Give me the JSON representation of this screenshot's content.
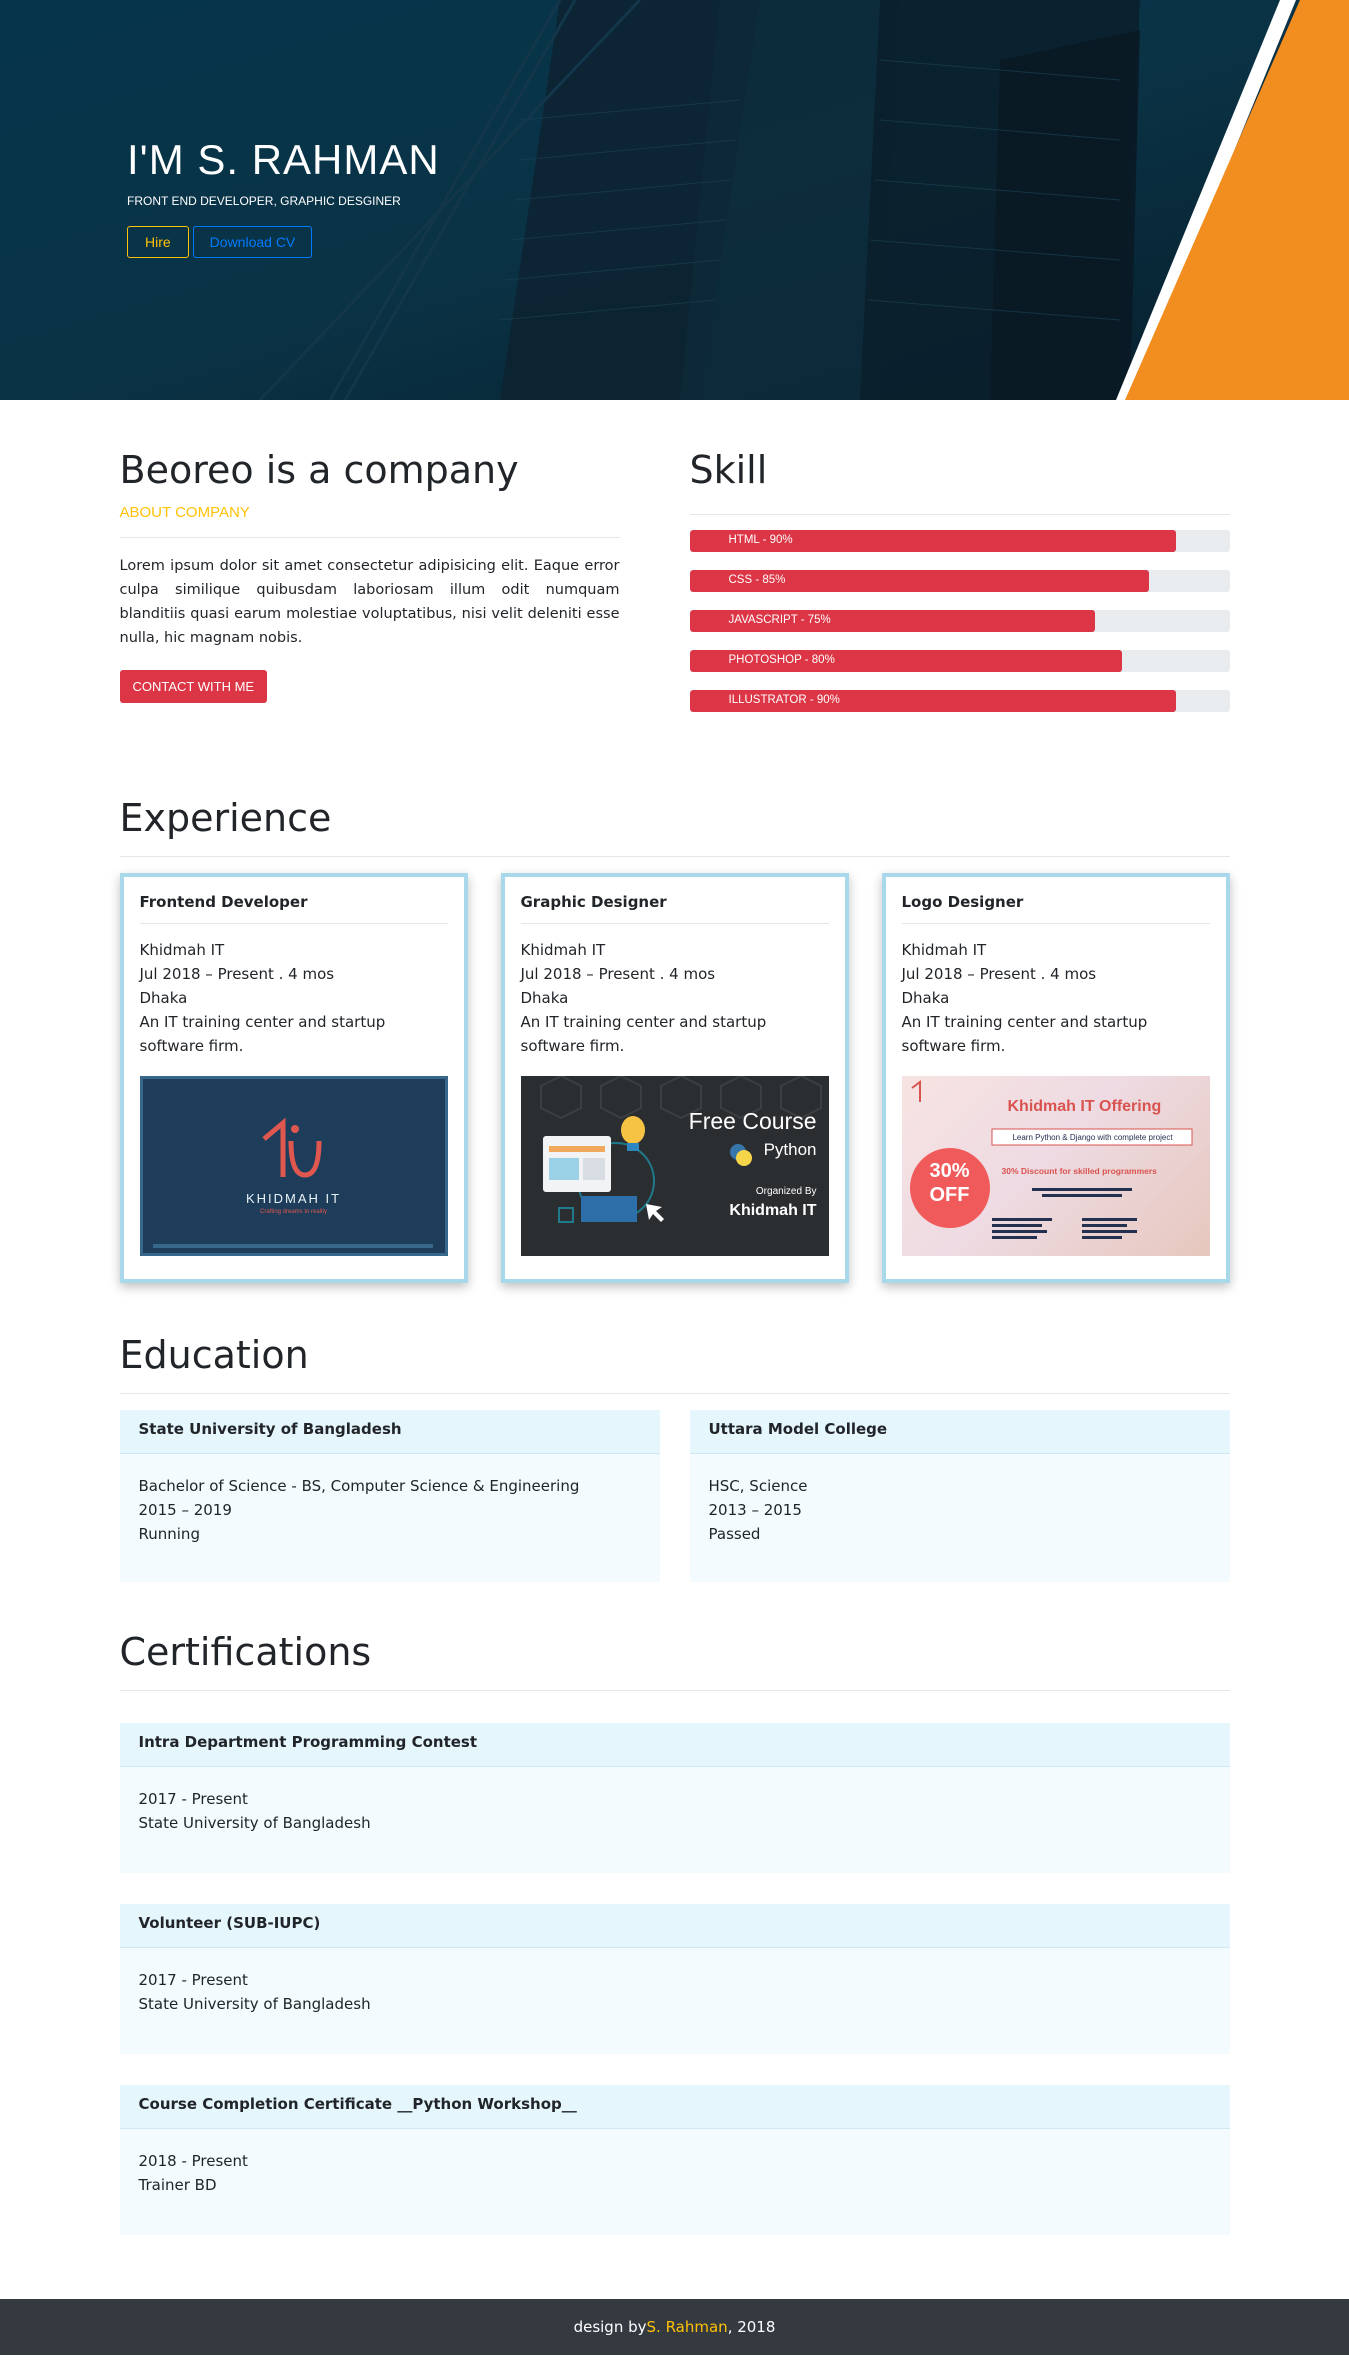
{
  "hero": {
    "title": "I'M S. RAHMAN",
    "subtitle": "FRONT END DEVELOPER, GRAPHIC DESGINER",
    "hire_label": "Hire",
    "download_label": "Download CV",
    "accent_color": "#f28d1f"
  },
  "about": {
    "title": "Beoreo is a company",
    "subtitle": "ABOUT COMPANY",
    "text": "Lorem ipsum dolor sit amet consectetur adipisicing elit. Eaque error culpa similique quibusdam laboriosam illum odit numquam blanditiis quasi earum molestiae voluptatibus, nisi velit deleniti esse nulla, hic magnam nobis.",
    "contact_label": "CONTACT WITH ME"
  },
  "skill": {
    "title": "Skill",
    "items": [
      {
        "label": "HTML - 90%",
        "percent": 90
      },
      {
        "label": "CSS - 85%",
        "percent": 85
      },
      {
        "label": "JAVASCRIPT - 75%",
        "percent": 75
      },
      {
        "label": "PHOTOSHOP - 80%",
        "percent": 80
      },
      {
        "label": "ILLUSTRATOR - 90%",
        "percent": 90
      }
    ]
  },
  "experience": {
    "title": "Experience",
    "items": [
      {
        "role": "Frontend Developer",
        "company": "Khidmah IT",
        "period": "Jul 2018 – Present . 4 mos",
        "location": "Dhaka",
        "description": "An IT training center and startup software firm.",
        "image_text": "KHIDMAH IT",
        "image_tagline": "Crafting dreams to reality"
      },
      {
        "role": "Graphic Designer",
        "company": "Khidmah IT",
        "period": "Jul 2018 – Present . 4 mos",
        "location": "Dhaka",
        "description": "An IT training center and startup software firm.",
        "image_text": "Free Course",
        "image_sub": "Python",
        "image_org_label": "Organized By",
        "image_org": "Khidmah IT"
      },
      {
        "role": "Logo Designer",
        "company": "Khidmah IT",
        "period": "Jul 2018 – Present . 4 mos",
        "location": "Dhaka",
        "description": "An IT training center and startup software firm.",
        "image_text": "Khidmah IT Offering",
        "image_sub": "Learn Python & Django with complete project",
        "image_discount": "30% Discount for skilled programmers",
        "image_badge_1": "30%",
        "image_badge_2": "OFF"
      }
    ]
  },
  "education": {
    "title": "Education",
    "items": [
      {
        "school": "State University of Bangladesh",
        "degree": "Bachelor of Science - BS, Computer Science & Engineering",
        "years": "2015 – 2019",
        "status": "Running"
      },
      {
        "school": "Uttara Model College",
        "degree": "HSC, Science",
        "years": "2013 – 2015",
        "status": "Passed"
      }
    ]
  },
  "certifications": {
    "title": "Certifications",
    "items": [
      {
        "name": "Intra Department Programming Contest",
        "period": "2017 - Present",
        "issuer": "State University of Bangladesh"
      },
      {
        "name": "Volunteer (SUB-IUPC)",
        "period": "2017 - Present",
        "issuer": "State University of Bangladesh"
      },
      {
        "name": "Course Completion Certificate __Python Workshop__",
        "period": "2018 - Present",
        "issuer": "Trainer BD"
      }
    ]
  },
  "footer": {
    "prefix": "design by ",
    "name": "S. Rahman",
    "suffix": ", 2018"
  }
}
